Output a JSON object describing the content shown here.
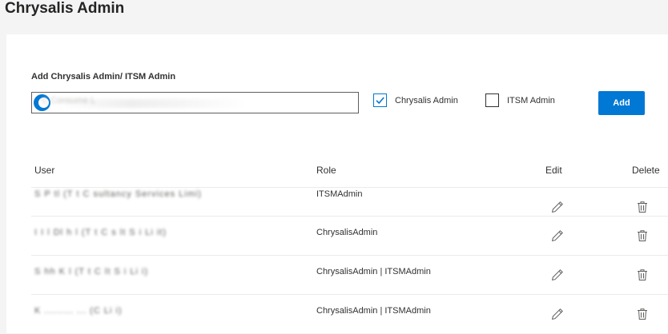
{
  "page": {
    "title": "Chrysalis Admin"
  },
  "form": {
    "label": "Add Chrysalis Admin/ ITSM Admin",
    "input_value": "C                                        Consume       L",
    "checkbox_chrysalis": {
      "label": "Chrysalis Admin",
      "checked": true
    },
    "checkbox_itsm": {
      "label": "ITSM Admin",
      "checked": false
    },
    "add_label": "Add"
  },
  "table": {
    "columns": {
      "user": "User",
      "role": "Role",
      "edit": "Edit",
      "delete": "Delete"
    },
    "rows": [
      {
        "user": "S    P  tl (T t  C    sultancy Services Limi)",
        "role": "ITSMAdmin"
      },
      {
        "user": "I    I   l Dl  h  l (T t  C  s lt    S  i  Li  it)",
        "role": "ChrysalisAdmin"
      },
      {
        "user": "S  hh    K    l  (T t  C   lt     S   i   Li  i)",
        "role": "ChrysalisAdmin | ITSMAdmin"
      },
      {
        "user": "K        ......... ...           (C        Li  i)",
        "role": "ChrysalisAdmin | ITSMAdmin"
      }
    ]
  },
  "colors": {
    "accent": "#0078d4",
    "background": "#f4f4f4",
    "card": "#ffffff"
  },
  "icons": {
    "edit": "pencil-icon",
    "delete": "trash-icon",
    "check": "checkmark-icon"
  }
}
